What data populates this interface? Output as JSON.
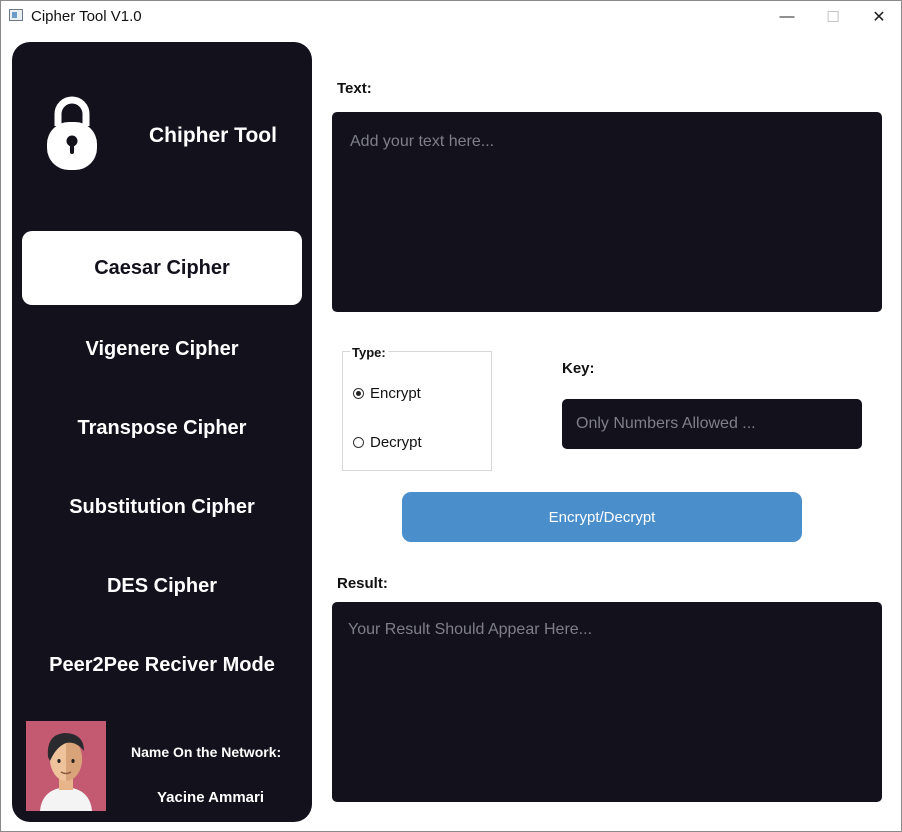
{
  "window": {
    "title": "Cipher Tool V1.0",
    "controls": {
      "minimize": "—",
      "maximize": "☐",
      "close": "✕"
    }
  },
  "sidebar": {
    "brand": "Chipher Tool",
    "items": [
      {
        "label": "Caesar Cipher",
        "active": true
      },
      {
        "label": "Vigenere Cipher",
        "active": false
      },
      {
        "label": "Transpose Cipher",
        "active": false
      },
      {
        "label": "Substitution Cipher",
        "active": false
      },
      {
        "label": "DES Cipher",
        "active": false
      },
      {
        "label": "Peer2Pee Reciver Mode",
        "active": false
      }
    ],
    "network_label": "Name On the Network:",
    "network_name": "Yacine Ammari"
  },
  "main": {
    "text_label": "Text:",
    "text_placeholder": "Add your text here...",
    "type_label": "Type:",
    "type_options": [
      {
        "label": "Encrypt",
        "checked": true
      },
      {
        "label": "Decrypt",
        "checked": false
      }
    ],
    "key_label": "Key:",
    "key_placeholder": "Only Numbers Allowed ...",
    "action_button": "Encrypt/Decrypt",
    "result_label": "Result:",
    "result_placeholder": "Your Result Should Appear Here..."
  },
  "colors": {
    "sidebar_bg": "#13121c",
    "accent_button": "#4a8fcc",
    "avatar_bg": "#c45a72"
  },
  "icons": [
    "app-icon",
    "lock-icon",
    "avatar"
  ]
}
